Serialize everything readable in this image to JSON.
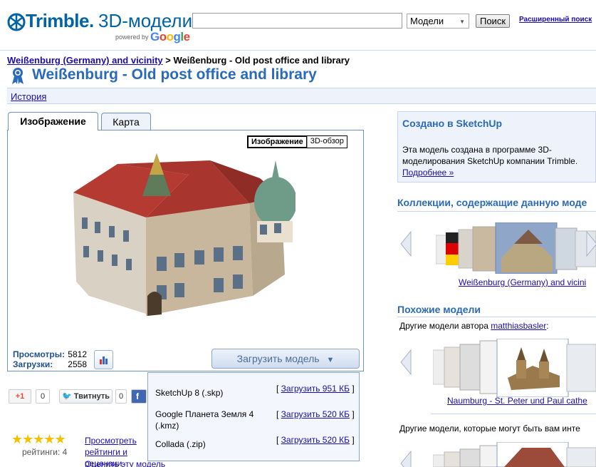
{
  "header": {
    "brand": "Trimble.",
    "product": "3D-модели",
    "powered_by": "powered by",
    "google": "Google",
    "search_placeholder": "",
    "search_value": "",
    "search_scope": "Модели",
    "search_button": "Поиск",
    "advanced_search": "Расширенный поиск"
  },
  "breadcrumb": {
    "parent": "Weißenburg (Germany) and vicinity",
    "separator": ">",
    "current": "Weißenburg - Old post office and library"
  },
  "page": {
    "title": "Weißenburg - Old post office and library",
    "history": "История"
  },
  "tabs": [
    {
      "label": "Изображение",
      "active": true
    },
    {
      "label": "Карта",
      "active": false
    }
  ],
  "viewer": {
    "toggle_image": "Изображение",
    "toggle_3d": "3D-обзор",
    "views_label": "Просмотры:",
    "views_value": "5812",
    "downloads_label": "Загрузки:",
    "downloads_value": "2558",
    "download_button": "Загрузить модель",
    "download_arrow": "▼"
  },
  "downloads": [
    {
      "format": "SketchUp 8 (.skp)",
      "link": "Загрузить 951 КБ"
    },
    {
      "format": "Google Планета Земля 4 (.kmz)",
      "link": "Загрузить 520 КБ"
    },
    {
      "format": "Collada (.zip)",
      "link": "Загрузить 520 КБ"
    }
  ],
  "social": {
    "gplus_label": "+1",
    "gplus_count": "0",
    "tweet_label": "Твитнуть",
    "tweet_count": "0",
    "fb_label": "f"
  },
  "rating": {
    "stars_display": "★★★★★",
    "stars": 5,
    "ratings_text": "рейтинги: 4",
    "see_reviews": "Просмотреть рейтинги и рецензии",
    "rate_model": "Оценить эту модель"
  },
  "sidebar": {
    "sketchup_title": "Создано в SketchUp",
    "sketchup_text": "Эта модель создана в программе 3D-моделирования SketchUp компании Trimble.",
    "sketchup_more": "Подробнее »",
    "collections_title": "Коллекции, содержащие данную моде",
    "collections_caption": "Weißenburg (Germany) and vicini",
    "similar_title": "Похожие модели",
    "author_prefix": "Другие модели автора",
    "author_name": "matthiasbasler",
    "author_suffix": ":",
    "author_caption": "Naumburg - St. Peter und Paul cathe",
    "interest_text": "Другие модели, которые могут быть вам инте"
  },
  "colors": {
    "brand_blue": "#0063a3",
    "title_blue": "#2a6ab8",
    "link": "#1a0dab",
    "panel_bg": "#eef3fb",
    "border": "#6f93bf"
  }
}
